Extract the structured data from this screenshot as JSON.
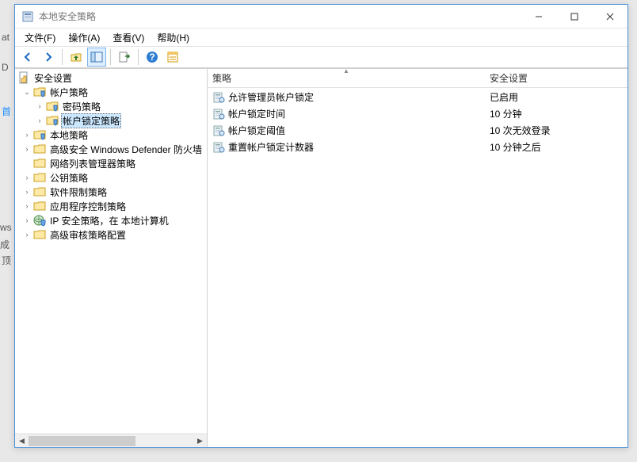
{
  "bg_hints": {
    "at": "at",
    "d": "D",
    "shou": "首",
    "ws": "ws",
    "cheng": "成",
    "ding": "顶"
  },
  "titlebar": {
    "title": "本地安全策略"
  },
  "menubar": {
    "file": "文件(F)",
    "action": "操作(A)",
    "view": "查看(V)",
    "help": "帮助(H)"
  },
  "tree": {
    "root": "安全设置",
    "account_policies": "帐户策略",
    "password_policy": "密码策略",
    "account_lockout_policy": "帐户锁定策略",
    "local_policies": "本地策略",
    "win_defender_firewall": "高级安全 Windows Defender 防火墙",
    "network_list_manager": "网络列表管理器策略",
    "public_key_policies": "公钥策略",
    "software_restriction": "软件限制策略",
    "app_control_policies": "应用程序控制策略",
    "ip_security": "IP 安全策略，在 本地计算机",
    "advanced_audit": "高级审核策略配置"
  },
  "list": {
    "col_policy": "策略",
    "col_setting": "安全设置",
    "rows": [
      {
        "policy": "允许管理员帐户锁定",
        "setting": "已启用"
      },
      {
        "policy": "帐户锁定时间",
        "setting": "10 分钟"
      },
      {
        "policy": "帐户锁定阈值",
        "setting": "10 次无效登录"
      },
      {
        "policy": "重置帐户锁定计数器",
        "setting": "10 分钟之后"
      }
    ]
  }
}
